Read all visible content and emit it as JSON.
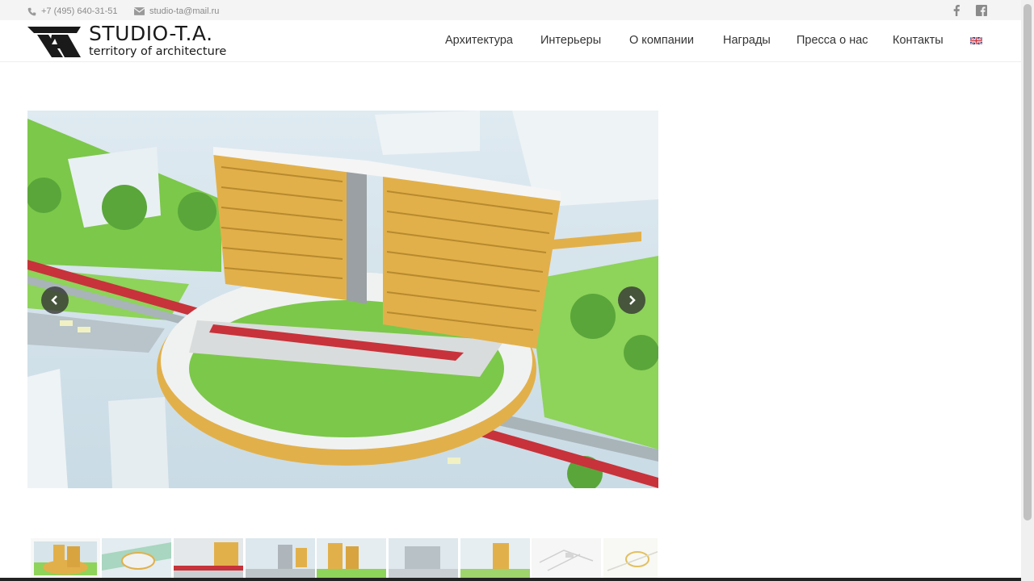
{
  "topbar": {
    "phone": "+7 (495) 640-31-51",
    "email": "studio-ta@mail.ru",
    "social": [
      "facebook-icon",
      "facebook-square-icon"
    ]
  },
  "brand": {
    "name": "STUDIO-T.A.",
    "tagline": "territory of architecture"
  },
  "nav": {
    "items": [
      {
        "label": "Архитектура"
      },
      {
        "label": "Интерьеры"
      },
      {
        "label": "О компании"
      },
      {
        "label": "Награды"
      },
      {
        "label": "Пресса о нас"
      },
      {
        "label": "Контакты"
      }
    ],
    "language_icon": "uk-flag-icon"
  },
  "gallery": {
    "prev_icon": "chevron-left-icon",
    "next_icon": "chevron-right-icon",
    "thumbnail_count": 9,
    "active_thumbnail": 1
  },
  "colors": {
    "topbar_bg": "#f4f4f4",
    "accent_gold": "#e2b04a",
    "grass": "#7cc84a",
    "rail_red": "#c8323a"
  }
}
